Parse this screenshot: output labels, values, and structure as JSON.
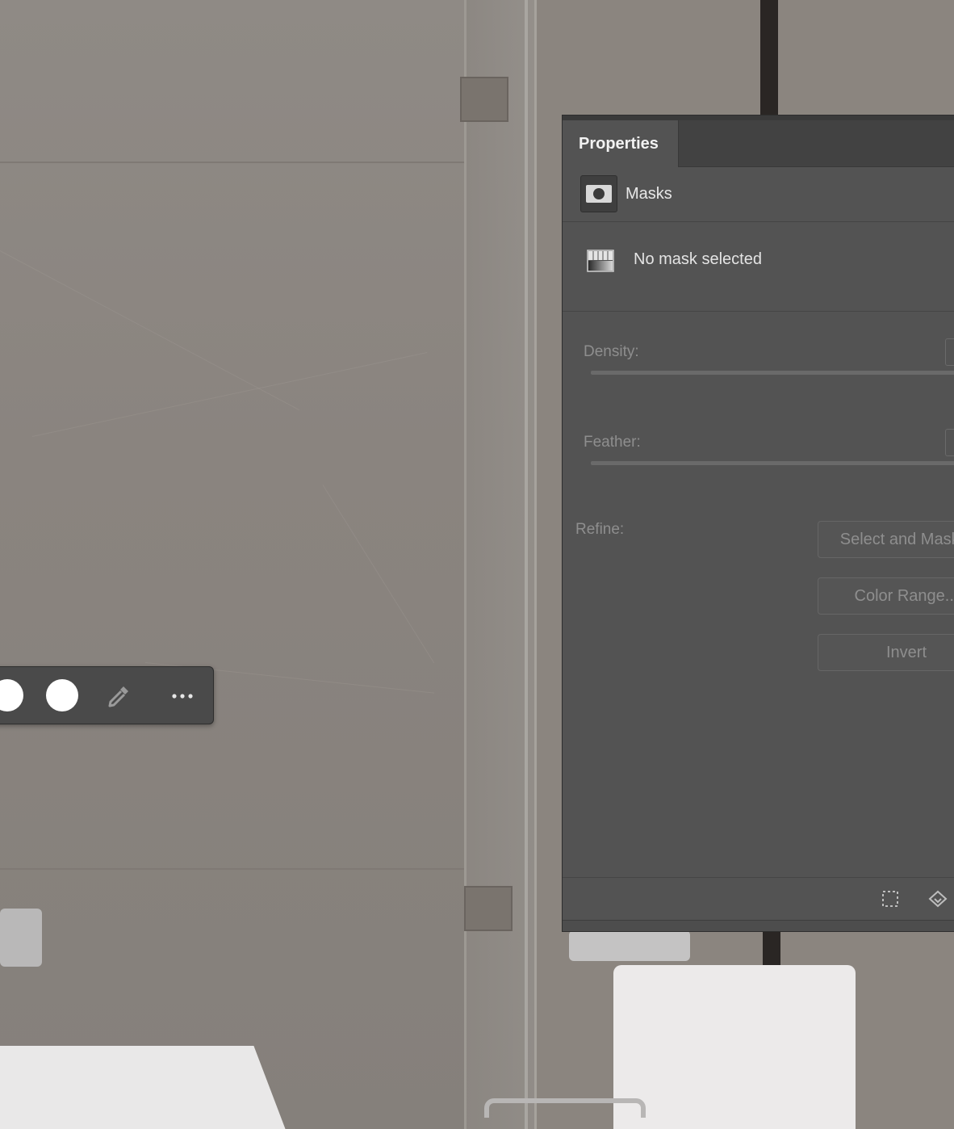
{
  "panel": {
    "tab_label": "Properties",
    "section_title": "Masks",
    "status_text": "No mask selected",
    "density_label": "Density:",
    "feather_label": "Feather:",
    "refine_label": "Refine:",
    "buttons": {
      "select_and_mask": "Select and Mask...",
      "color_range": "Color Range...",
      "invert": "Invert"
    },
    "icons": {
      "section": "layer-mask-icon",
      "no_mask": "gradient-mask-icon",
      "footer": [
        "load-selection-icon",
        "apply-mask-icon"
      ]
    }
  },
  "floating_toolbar": {
    "swatches": [
      "#ffffff",
      "#ffffff"
    ],
    "icons": [
      "color-swatch",
      "color-swatch",
      "eyedropper-icon",
      "more-options-icon"
    ]
  },
  "colors": {
    "panel_bg": "#535353",
    "tab_bar_bg": "#424242",
    "disabled_text": "#8e8e8e"
  }
}
